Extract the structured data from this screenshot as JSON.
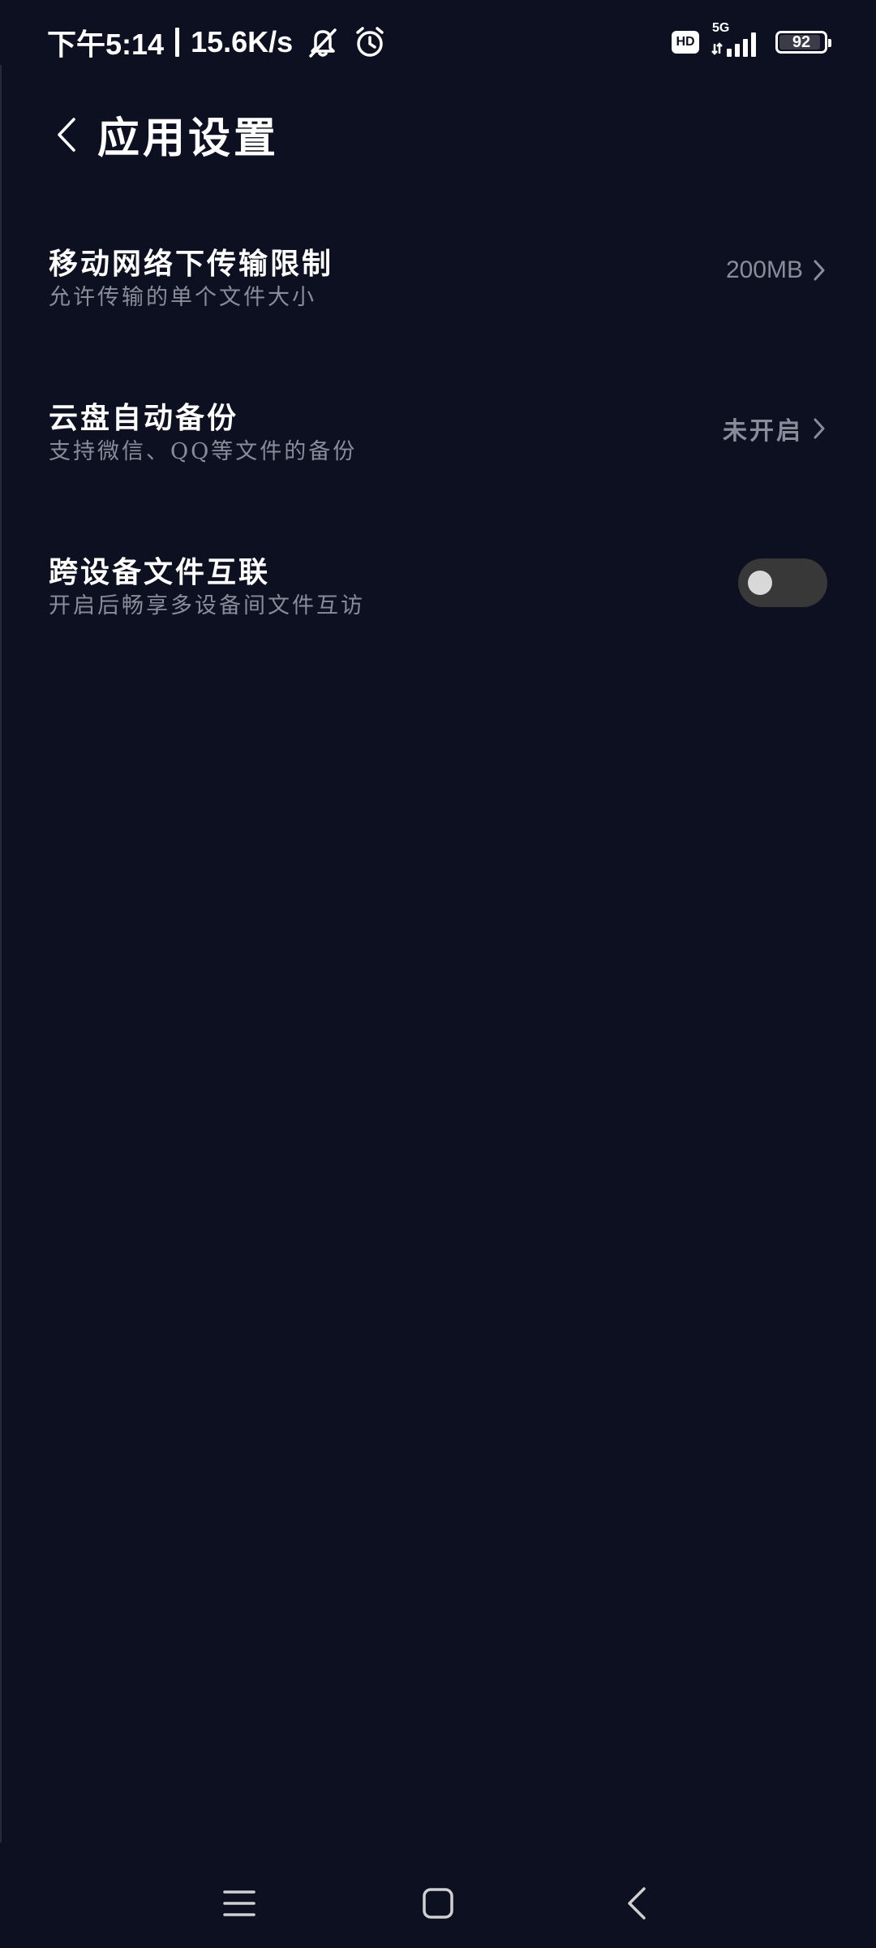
{
  "status_bar": {
    "time": "下午5:14",
    "net_speed": "15.6K/s",
    "hd_label": "HD",
    "network_type": "5G",
    "battery_level": "92",
    "battery_fraction": 0.92,
    "icons": [
      "bell-off-icon",
      "alarm-icon",
      "signal-icon"
    ]
  },
  "header": {
    "title": "应用设置",
    "back_icon": "chevron-left-icon"
  },
  "settings": [
    {
      "title": "移动网络下传输限制",
      "subtitle": "允许传输的单个文件大小",
      "value": "200MB"
    },
    {
      "title": "云盘自动备份",
      "subtitle": "支持微信、QQ等文件的备份",
      "value": "未开启"
    },
    {
      "title": "跨设备文件互联",
      "subtitle": "开启后畅享多设备间文件互访",
      "toggle_on": false
    }
  ],
  "nav_bar": {
    "icons": [
      "menu-icon",
      "home-icon",
      "back-icon"
    ]
  },
  "colors": {
    "background": "#0d1020",
    "primary_text": "#ffffff",
    "secondary_text": "#8a8d99",
    "toggle_track": "#383838",
    "toggle_knob": "#d8d8d8"
  }
}
